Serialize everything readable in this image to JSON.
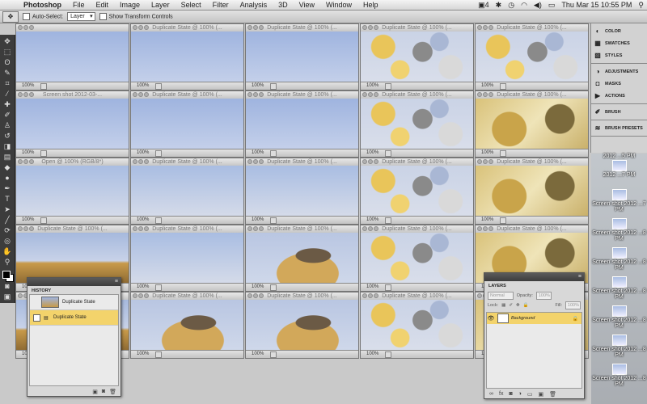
{
  "menubar": {
    "app_name": "Photoshop",
    "menus": [
      "File",
      "Edit",
      "Image",
      "Layer",
      "Select",
      "Filter",
      "Analysis",
      "3D",
      "View",
      "Window",
      "Help"
    ],
    "status": {
      "ps_badge": "4",
      "clock": "Thu Mar 15  10:55 PM"
    }
  },
  "options_bar": {
    "auto_select_label": "Auto-Select:",
    "auto_select_value": "Layer",
    "transform_label": "Show Transform Controls"
  },
  "documents": [
    {
      "title": "",
      "zoom": "100%",
      "art": "sky"
    },
    {
      "title": "Duplicate State @ 100% (...",
      "zoom": "100%",
      "art": "sky"
    },
    {
      "title": "Duplicate State @ 100% (...",
      "zoom": "100%",
      "art": "sky"
    },
    {
      "title": "Duplicate State @ 100% (...",
      "zoom": "100%",
      "art": "balls"
    },
    {
      "title": "Duplicate State @ 100% (...",
      "zoom": "100%",
      "art": "balls"
    },
    {
      "title": "Screen shot 2012-03-...",
      "zoom": "100%",
      "art": "sky"
    },
    {
      "title": "Duplicate State @ 100% (...",
      "zoom": "100%",
      "art": "sky"
    },
    {
      "title": "Duplicate State @ 100% (...",
      "zoom": "100%",
      "art": "sky"
    },
    {
      "title": "Duplicate State @ 100% (...",
      "zoom": "100%",
      "art": "balls"
    },
    {
      "title": "Duplicate State @ 100% (...",
      "zoom": "100%",
      "art": "gold"
    },
    {
      "title": "Open @ 100% (RGB/8*)",
      "zoom": "100%",
      "art": "sky2"
    },
    {
      "title": "Duplicate State @ 100% (...",
      "zoom": "100%",
      "art": "sky2"
    },
    {
      "title": "Duplicate State @ 100% (...",
      "zoom": "100%",
      "art": "sky2"
    },
    {
      "title": "Duplicate State @ 100% (...",
      "zoom": "100%",
      "art": "balls"
    },
    {
      "title": "Duplicate State @ 100% (...",
      "zoom": "100%",
      "art": "gold"
    },
    {
      "title": "Duplicate State @ 100% (...",
      "zoom": "100%",
      "art": "desert"
    },
    {
      "title": "Duplicate State @ 100% (...",
      "zoom": "100%",
      "art": "sky2"
    },
    {
      "title": "Duplicate State @ 100% (...",
      "zoom": "100%",
      "art": "figure"
    },
    {
      "title": "Duplicate State @ 100% (...",
      "zoom": "100%",
      "art": "balls"
    },
    {
      "title": "Duplicate State @ 100% (...",
      "zoom": "100%",
      "art": "gold"
    },
    {
      "title": "Duplicate State @ 100% (...",
      "zoom": "100%",
      "art": "desert"
    },
    {
      "title": "Duplicate State @ 100% (...",
      "zoom": "100%",
      "art": "figure"
    },
    {
      "title": "Duplicate State @ 100% (...",
      "zoom": "100%",
      "art": "figure"
    },
    {
      "title": "Duplicate State @ 100% (...",
      "zoom": "100%",
      "art": "balls"
    },
    {
      "title": "Duplicate State @ 100% (...",
      "zoom": "100%",
      "art": "gold"
    }
  ],
  "dock": {
    "group1": [
      "COLOR",
      "SWATCHES",
      "STYLES"
    ],
    "group2": [
      "ADJUSTMENTS",
      "MASKS",
      "ACTIONS"
    ],
    "group3": [
      "BRUSH"
    ],
    "group4": [
      "BRUSH PRESETS"
    ]
  },
  "desktop_icons": [
    "2012 ...5 PM",
    "2012 ...7 PM",
    "Screen shot 2012 ...7 PM",
    "Screen shot 2012 ...8 PM",
    "Screen shot 2012 ...8 PM",
    "Screen shot 2012 ...8 PM",
    "Screen shot 2012 ...8 PM",
    "Screen shot 2012 ...8 PM",
    "Screen shot 2012 ...8 PM"
  ],
  "history": {
    "tab": "HISTORY",
    "snapshot_label": "Duplicate State",
    "state_label": "Duplicate State"
  },
  "layers": {
    "tab": "LAYERS",
    "blend_mode": "Normal",
    "opacity_label": "Opacity:",
    "opacity_value": "100%",
    "lock_label": "Lock:",
    "fill_label": "Fill:",
    "fill_value": "100%",
    "layer_name": "Background"
  },
  "colors": {
    "selection": "#f3d36b",
    "panel_header": "#3c3c3c"
  }
}
